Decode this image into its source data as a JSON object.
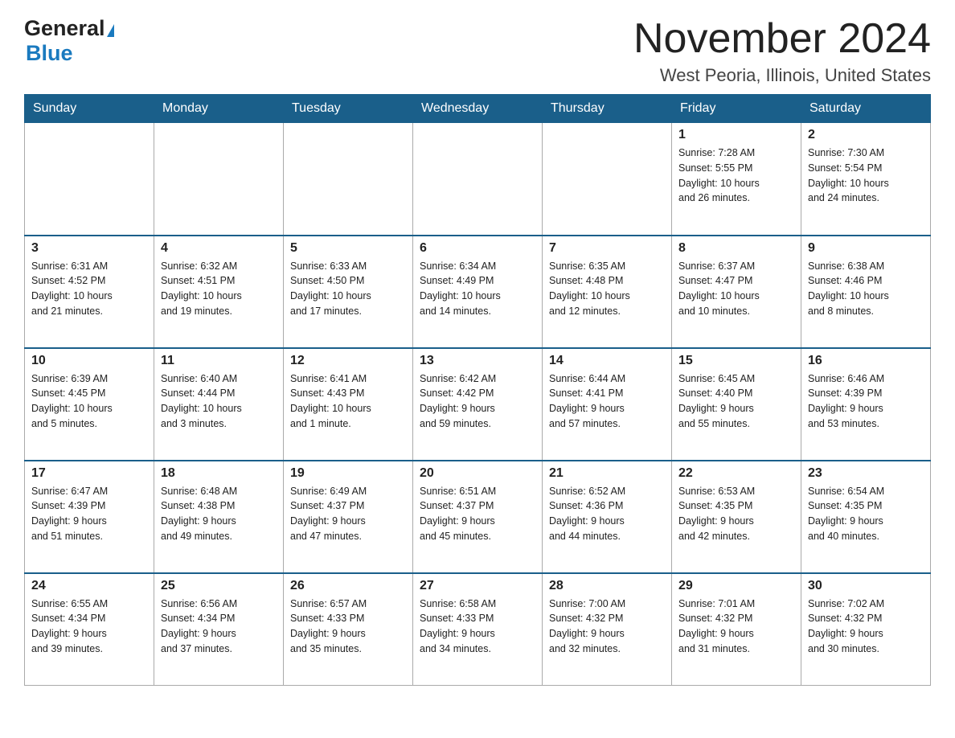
{
  "header": {
    "logo_general": "General",
    "logo_arrow": "▶",
    "logo_blue": "Blue",
    "month_title": "November 2024",
    "location": "West Peoria, Illinois, United States"
  },
  "days_of_week": [
    "Sunday",
    "Monday",
    "Tuesday",
    "Wednesday",
    "Thursday",
    "Friday",
    "Saturday"
  ],
  "weeks": [
    {
      "days": [
        {
          "number": "",
          "info": ""
        },
        {
          "number": "",
          "info": ""
        },
        {
          "number": "",
          "info": ""
        },
        {
          "number": "",
          "info": ""
        },
        {
          "number": "",
          "info": ""
        },
        {
          "number": "1",
          "info": "Sunrise: 7:28 AM\nSunset: 5:55 PM\nDaylight: 10 hours\nand 26 minutes."
        },
        {
          "number": "2",
          "info": "Sunrise: 7:30 AM\nSunset: 5:54 PM\nDaylight: 10 hours\nand 24 minutes."
        }
      ]
    },
    {
      "days": [
        {
          "number": "3",
          "info": "Sunrise: 6:31 AM\nSunset: 4:52 PM\nDaylight: 10 hours\nand 21 minutes."
        },
        {
          "number": "4",
          "info": "Sunrise: 6:32 AM\nSunset: 4:51 PM\nDaylight: 10 hours\nand 19 minutes."
        },
        {
          "number": "5",
          "info": "Sunrise: 6:33 AM\nSunset: 4:50 PM\nDaylight: 10 hours\nand 17 minutes."
        },
        {
          "number": "6",
          "info": "Sunrise: 6:34 AM\nSunset: 4:49 PM\nDaylight: 10 hours\nand 14 minutes."
        },
        {
          "number": "7",
          "info": "Sunrise: 6:35 AM\nSunset: 4:48 PM\nDaylight: 10 hours\nand 12 minutes."
        },
        {
          "number": "8",
          "info": "Sunrise: 6:37 AM\nSunset: 4:47 PM\nDaylight: 10 hours\nand 10 minutes."
        },
        {
          "number": "9",
          "info": "Sunrise: 6:38 AM\nSunset: 4:46 PM\nDaylight: 10 hours\nand 8 minutes."
        }
      ]
    },
    {
      "days": [
        {
          "number": "10",
          "info": "Sunrise: 6:39 AM\nSunset: 4:45 PM\nDaylight: 10 hours\nand 5 minutes."
        },
        {
          "number": "11",
          "info": "Sunrise: 6:40 AM\nSunset: 4:44 PM\nDaylight: 10 hours\nand 3 minutes."
        },
        {
          "number": "12",
          "info": "Sunrise: 6:41 AM\nSunset: 4:43 PM\nDaylight: 10 hours\nand 1 minute."
        },
        {
          "number": "13",
          "info": "Sunrise: 6:42 AM\nSunset: 4:42 PM\nDaylight: 9 hours\nand 59 minutes."
        },
        {
          "number": "14",
          "info": "Sunrise: 6:44 AM\nSunset: 4:41 PM\nDaylight: 9 hours\nand 57 minutes."
        },
        {
          "number": "15",
          "info": "Sunrise: 6:45 AM\nSunset: 4:40 PM\nDaylight: 9 hours\nand 55 minutes."
        },
        {
          "number": "16",
          "info": "Sunrise: 6:46 AM\nSunset: 4:39 PM\nDaylight: 9 hours\nand 53 minutes."
        }
      ]
    },
    {
      "days": [
        {
          "number": "17",
          "info": "Sunrise: 6:47 AM\nSunset: 4:39 PM\nDaylight: 9 hours\nand 51 minutes."
        },
        {
          "number": "18",
          "info": "Sunrise: 6:48 AM\nSunset: 4:38 PM\nDaylight: 9 hours\nand 49 minutes."
        },
        {
          "number": "19",
          "info": "Sunrise: 6:49 AM\nSunset: 4:37 PM\nDaylight: 9 hours\nand 47 minutes."
        },
        {
          "number": "20",
          "info": "Sunrise: 6:51 AM\nSunset: 4:37 PM\nDaylight: 9 hours\nand 45 minutes."
        },
        {
          "number": "21",
          "info": "Sunrise: 6:52 AM\nSunset: 4:36 PM\nDaylight: 9 hours\nand 44 minutes."
        },
        {
          "number": "22",
          "info": "Sunrise: 6:53 AM\nSunset: 4:35 PM\nDaylight: 9 hours\nand 42 minutes."
        },
        {
          "number": "23",
          "info": "Sunrise: 6:54 AM\nSunset: 4:35 PM\nDaylight: 9 hours\nand 40 minutes."
        }
      ]
    },
    {
      "days": [
        {
          "number": "24",
          "info": "Sunrise: 6:55 AM\nSunset: 4:34 PM\nDaylight: 9 hours\nand 39 minutes."
        },
        {
          "number": "25",
          "info": "Sunrise: 6:56 AM\nSunset: 4:34 PM\nDaylight: 9 hours\nand 37 minutes."
        },
        {
          "number": "26",
          "info": "Sunrise: 6:57 AM\nSunset: 4:33 PM\nDaylight: 9 hours\nand 35 minutes."
        },
        {
          "number": "27",
          "info": "Sunrise: 6:58 AM\nSunset: 4:33 PM\nDaylight: 9 hours\nand 34 minutes."
        },
        {
          "number": "28",
          "info": "Sunrise: 7:00 AM\nSunset: 4:32 PM\nDaylight: 9 hours\nand 32 minutes."
        },
        {
          "number": "29",
          "info": "Sunrise: 7:01 AM\nSunset: 4:32 PM\nDaylight: 9 hours\nand 31 minutes."
        },
        {
          "number": "30",
          "info": "Sunrise: 7:02 AM\nSunset: 4:32 PM\nDaylight: 9 hours\nand 30 minutes."
        }
      ]
    }
  ]
}
